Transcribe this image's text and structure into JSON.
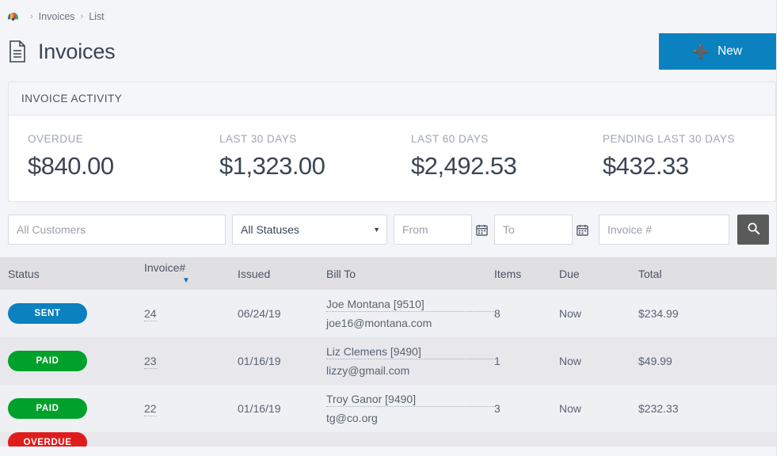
{
  "breadcrumb": {
    "home_icon": "dashboard-gauge-icon",
    "items": [
      "Invoices",
      "List"
    ],
    "separator": "›"
  },
  "header": {
    "title": "Invoices",
    "title_icon": "document-icon",
    "new_button": {
      "label": "New",
      "icon": "plus-icon",
      "color": "#0b81c0"
    }
  },
  "activity": {
    "panel_title": "INVOICE ACTIVITY",
    "stats": [
      {
        "label": "OVERDUE",
        "value": "$840.00"
      },
      {
        "label": "LAST 30 DAYS",
        "value": "$1,323.00"
      },
      {
        "label": "LAST 60 DAYS",
        "value": "$2,492.53"
      },
      {
        "label": "PENDING LAST 30 DAYS",
        "value": "$432.33"
      }
    ]
  },
  "filters": {
    "customer": {
      "placeholder": "All Customers",
      "value": ""
    },
    "status": {
      "selected": "All Statuses",
      "options": [
        "All Statuses"
      ],
      "caret_icon": "chevron-down-icon"
    },
    "date_from": {
      "placeholder": "From",
      "value": "",
      "icon": "calendar-icon"
    },
    "date_to": {
      "placeholder": "To",
      "value": "",
      "icon": "calendar-icon"
    },
    "invoice_number": {
      "placeholder": "Invoice #",
      "value": ""
    },
    "search_button": {
      "icon": "search-icon",
      "color": "#5a5a5a"
    }
  },
  "table": {
    "columns": {
      "status": "Status",
      "invoice": "Invoice#",
      "issued": "Issued",
      "billto": "Bill To",
      "items": "Items",
      "due": "Due",
      "total": "Total"
    },
    "sort": {
      "column": "Invoice#",
      "direction": "desc",
      "icon": "caret-down-icon",
      "color": "#1a6fb5"
    },
    "rows": [
      {
        "status": "SENT",
        "status_color": "#0b81c0",
        "invoice": "24",
        "issued": "06/24/19",
        "billto_name": "Joe Montana [9510]",
        "billto_email": "joe16@montana.com",
        "items": "8",
        "due": "Now",
        "total": "$234.99"
      },
      {
        "status": "PAID",
        "status_color": "#00a12b",
        "invoice": "23",
        "issued": "01/16/19",
        "billto_name": "Liz Clemens [9490]",
        "billto_email": "lizzy@gmail.com",
        "items": "1",
        "due": "Now",
        "total": "$49.99"
      },
      {
        "status": "PAID",
        "status_color": "#00a12b",
        "invoice": "22",
        "issued": "01/16/19",
        "billto_name": "Troy Ganor [9490]",
        "billto_email": "tg@co.org",
        "items": "3",
        "due": "Now",
        "total": "$232.33"
      },
      {
        "status": "OVERDUE",
        "status_color": "#e01b1b",
        "invoice": "",
        "issued": "",
        "billto_name": "",
        "billto_email": "",
        "items": "",
        "due": "",
        "total": ""
      }
    ]
  }
}
